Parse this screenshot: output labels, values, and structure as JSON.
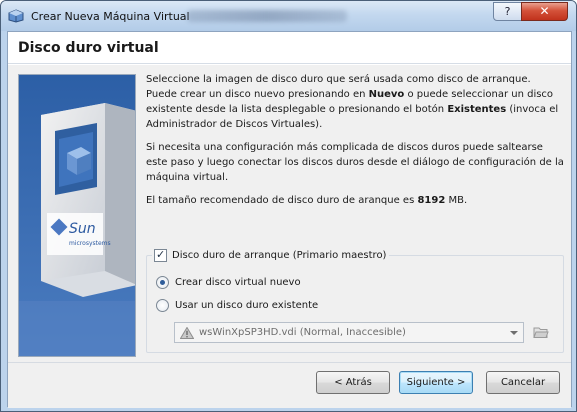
{
  "window": {
    "title": "Crear Nueva Máquina Virtual",
    "help_label": "?",
    "close_label": "✕"
  },
  "page": {
    "title": "Disco duro virtual"
  },
  "description": {
    "p1_a": "Seleccione la imagen de disco duro que será usada como disco de arranque. Puede crear un disco nuevo presionando en ",
    "p1_b": "Nuevo",
    "p1_c": " o puede seleccionar un disco existente desde la lista desplegable o presionando el botón ",
    "p1_d": "Existentes",
    "p1_e": " (invoca el Administrador de Discos Virtuales).",
    "p2": "Si necesita una configuración más complicada de discos duros puede saltearse este paso y luego conectar los discos duros desde el diálogo de configuración de la máquina virtual.",
    "p3_a": "El tamaño recomendado de disco duro de aranque es ",
    "p3_b": "8192",
    "p3_c": " MB."
  },
  "boot_disk": {
    "label": "Disco duro de arranque (Primario maestro)",
    "checked": true,
    "options": [
      {
        "label": "Crear disco virtual nuevo",
        "selected": true
      },
      {
        "label": "Usar un disco duro existente",
        "selected": false
      }
    ],
    "existing_disk": {
      "value": "wsWinXpSP3HD.vdi (Normal, Inaccesible)",
      "enabled": false
    }
  },
  "buttons": {
    "back": "< Atrás",
    "next": "Siguiente >",
    "cancel": "Cancelar"
  },
  "side_image": {
    "brand": "Sun",
    "brand_sub": "microsystems"
  },
  "colors": {
    "accent": "#3c7fb1",
    "close": "#c1321c",
    "side_panel": "#3a68a8"
  },
  "icons": {
    "app": "virtualbox-icon",
    "warning": "warning-icon",
    "folder": "folder-open-icon"
  }
}
